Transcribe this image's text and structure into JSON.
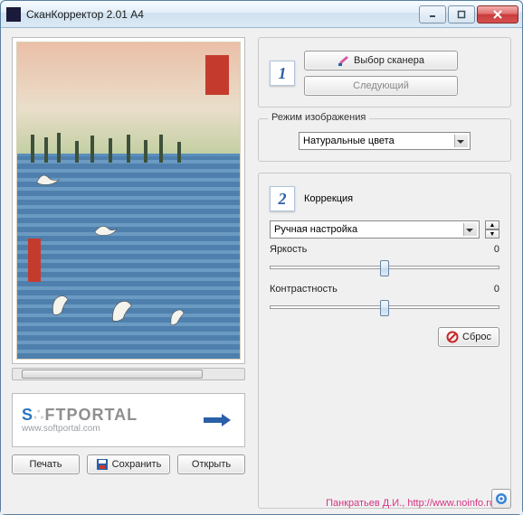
{
  "window": {
    "title": "СканКорректор 2.01 A4"
  },
  "left": {
    "logo_brand_part1": "S",
    "logo_brand_part2": "FTPORTAL",
    "logo_url": "www.softportal.com",
    "print_label": "Печать",
    "save_label": "Сохранить",
    "open_label": "Открыть"
  },
  "step1": {
    "number": "1",
    "scanner_btn": "Выбор сканера",
    "next_btn": "Следующий"
  },
  "image_mode": {
    "legend": "Режим изображения",
    "value": "Натуральные цвета"
  },
  "step2": {
    "number": "2",
    "title": "Коррекция",
    "mode_value": "Ручная настройка",
    "brightness_label": "Яркость",
    "brightness_value": "0",
    "contrast_label": "Контрастность",
    "contrast_value": "0",
    "reset_label": "Сброс"
  },
  "footer": {
    "text": "Панкратьев Д.И., http://www.noinfo.ru"
  }
}
